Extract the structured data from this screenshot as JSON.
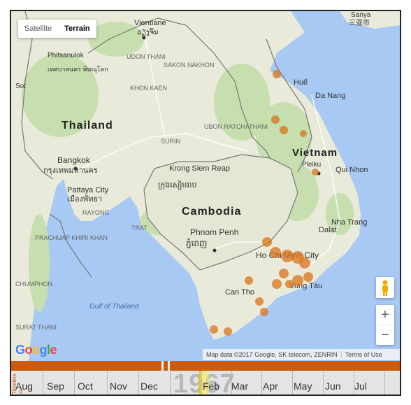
{
  "map_type": {
    "satellite": "Satellite",
    "terrain": "Terrain",
    "selected": "Terrain"
  },
  "countries": {
    "thailand": "Thailand",
    "cambodia": "Cambodia",
    "vietnam": "Vietnam"
  },
  "cities": {
    "vientiane": "Vientiane",
    "vientiane_lao": "ວຽງຈັນ",
    "sanya": "Sanya",
    "sanya_cn": "三亚市",
    "phitsanulok": "Phitsanulok",
    "phitsanulok_th": "เทศบาลนคร พิษณุโลก",
    "udon_thani": "UDON THANI",
    "sakon_nakhon": "SAKON NAKHON",
    "khon_kaen": "KHON KAEN",
    "hue": "Huế",
    "da_nang": "Da Nang",
    "ubon": "UBON RATCHATHANI",
    "surin": "SURIN",
    "bangkok": "Bangkok",
    "bangkok_th": "กรุงเทพมหานคร",
    "krong_siem_reap": "Krong Siem Reap",
    "siem_reap_km": "ក្រុងសៀមរាប",
    "pleiku": "Pleiku",
    "quy_nhon": "Qui Nhon",
    "pattaya": "Pattaya City",
    "pattaya_th": "เมืองพัทยา",
    "rayong": "RAYONG",
    "trat": "TRAT",
    "nha_trang": "Nha Trang",
    "dalat": "Dalat",
    "phnom_penh": "Phnom Penh",
    "phnom_penh_km": "ភ្នំពេញ",
    "prachuap": "PRACHUAP KHIRI KHAN",
    "chumphon": "CHUMPHON",
    "ho_chi_minh": "Ho Chi Minh City",
    "vung_tau": "Vung Tàu",
    "can_tho": "Can Tho",
    "gulf": "Gulf of Thailand",
    "surat": "SURAT THANI",
    "sot": "Sot"
  },
  "attribution": {
    "map_data": "Map data ©2017 Google, SK telecom, ZENRIN",
    "terms": "Terms of Use"
  },
  "controls": {
    "zoom_in": "+",
    "zoom_out": "−",
    "logo": "Google"
  },
  "timeline": {
    "label": "Timeline ©",
    "year": "1967",
    "months": [
      "Aug",
      "Sep",
      "Oct",
      "Nov",
      "Dec",
      "Feb",
      "Mar",
      "Apr",
      "May",
      "Jun",
      "Jul"
    ],
    "bar_color": "#cc5c0d"
  },
  "marker_color": "#d9731a",
  "colors": {
    "water": "#a8c9f4",
    "land": "#e9ead9",
    "forest": "#c7dfae",
    "border": "#666666"
  }
}
